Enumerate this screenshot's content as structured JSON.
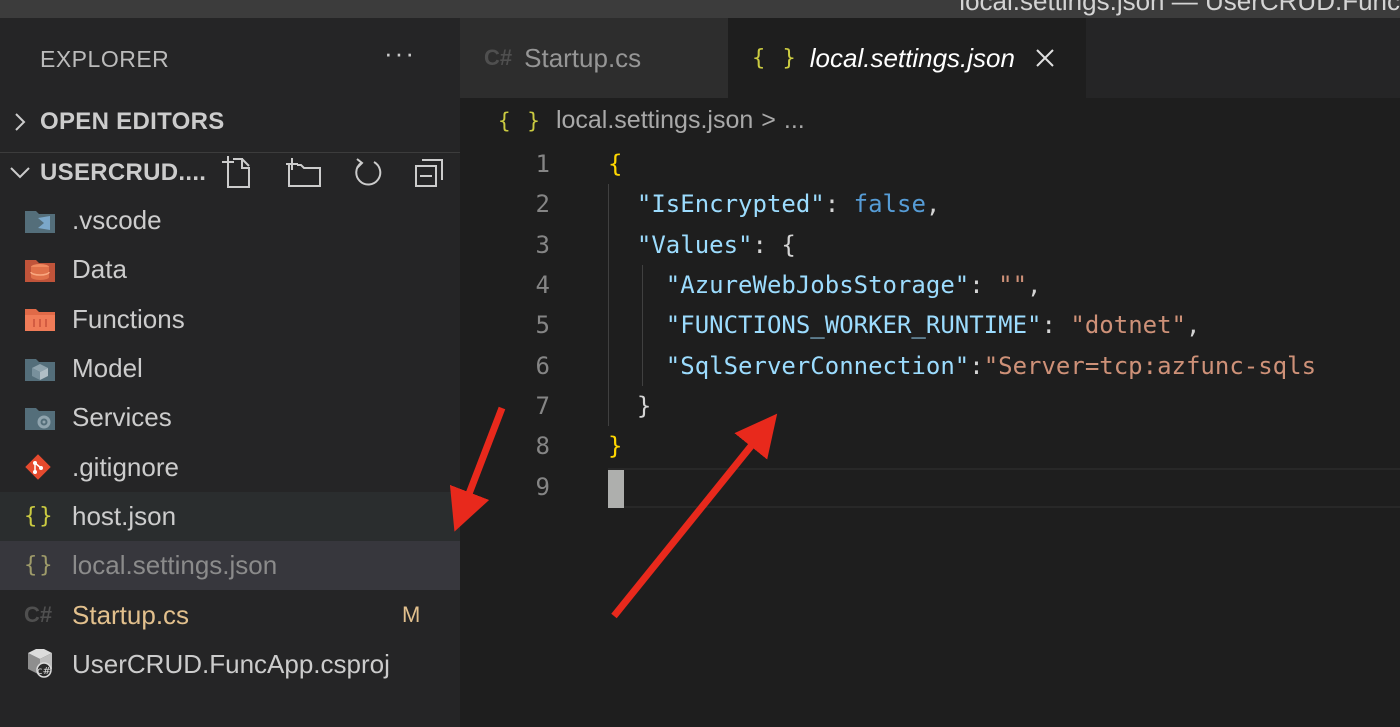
{
  "titlebar": {
    "title": "local.settings.json — UserCRUD.Func"
  },
  "sidebar": {
    "header": "EXPLORER",
    "more_label": "···",
    "open_editors": "OPEN EDITORS",
    "workspace": "USERCRUD....",
    "items": [
      {
        "label": ".vscode",
        "icon": "vscode-folder-icon"
      },
      {
        "label": "Data",
        "icon": "data-folder-icon"
      },
      {
        "label": "Functions",
        "icon": "functions-folder-icon"
      },
      {
        "label": "Model",
        "icon": "model-folder-icon"
      },
      {
        "label": "Services",
        "icon": "services-folder-icon"
      },
      {
        "label": ".gitignore",
        "icon": "git-icon"
      },
      {
        "label": "host.json",
        "icon": "json-icon"
      },
      {
        "label": "local.settings.json",
        "icon": "json-icon"
      },
      {
        "label": "Startup.cs",
        "icon": "csharp-icon",
        "badge": "M"
      },
      {
        "label": "UserCRUD.FuncApp.csproj",
        "icon": "csproj-icon"
      }
    ]
  },
  "editor": {
    "tabs": [
      {
        "label": "Startup.cs",
        "icon_text": "C#"
      },
      {
        "label": "local.settings.json",
        "icon_text": "{ }"
      }
    ],
    "breadcrumb": {
      "icon_text": "{ }",
      "file": "local.settings.json",
      "sep": ">",
      "rest": "..."
    },
    "line_numbers": [
      "1",
      "2",
      "3",
      "4",
      "5",
      "6",
      "7",
      "8",
      "9"
    ],
    "code": {
      "l1_brace": "{",
      "l2_key": "\"IsEncrypted\"",
      "l2_colon": ": ",
      "l2_val": "false",
      "l2_comma": ",",
      "l3_key": "\"Values\"",
      "l3_rest": ": {",
      "l4_key": "\"AzureWebJobsStorage\"",
      "l4_colon": ": ",
      "l4_val": "\"\"",
      "l4_comma": ",",
      "l5_key": "\"FUNCTIONS_WORKER_RUNTIME\"",
      "l5_colon": ": ",
      "l5_val": "\"dotnet\"",
      "l5_comma": ",",
      "l6_key": "\"SqlServerConnection\"",
      "l6_colon": ":",
      "l6_val": "\"Server=tcp:azfunc-sqls",
      "l7_brace": "}",
      "l8_brace": "}"
    }
  },
  "colors": {
    "annotation_arrow": "#e8291c",
    "json_brace_icon": "#cbcb41",
    "modified": "#e2c08d"
  }
}
